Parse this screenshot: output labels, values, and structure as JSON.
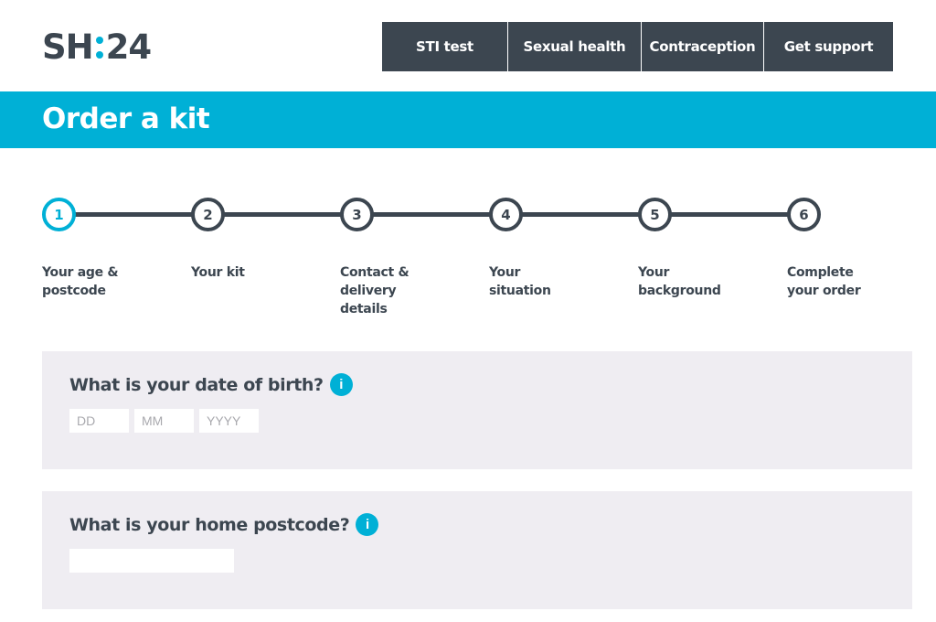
{
  "logo": {
    "left": "SH",
    "right": "24"
  },
  "nav": {
    "items": [
      {
        "label": "STI test"
      },
      {
        "label": "Sexual health"
      },
      {
        "label": "Contraception"
      },
      {
        "label": "Get support"
      }
    ]
  },
  "banner": {
    "title": "Order a kit"
  },
  "steps": {
    "current": 1,
    "items": [
      {
        "number": "1",
        "label": "Your age & postcode"
      },
      {
        "number": "2",
        "label": "Your kit"
      },
      {
        "number": "3",
        "label": "Contact & delivery details"
      },
      {
        "number": "4",
        "label": "Your situation"
      },
      {
        "number": "5",
        "label": "Your background"
      },
      {
        "number": "6",
        "label": "Complete your order"
      }
    ]
  },
  "form": {
    "dob": {
      "question": "What is your date of birth?",
      "info_icon": "i",
      "day": {
        "value": "",
        "placeholder": "DD"
      },
      "month": {
        "value": "",
        "placeholder": "MM"
      },
      "year": {
        "value": "",
        "placeholder": "YYYY"
      }
    },
    "postcode": {
      "question": "What is your home postcode?",
      "info_icon": "i",
      "value": "",
      "placeholder": ""
    }
  },
  "colors": {
    "brand_dark": "#3c4650",
    "accent": "#00b0d6",
    "panel_bg": "#efedf2"
  }
}
